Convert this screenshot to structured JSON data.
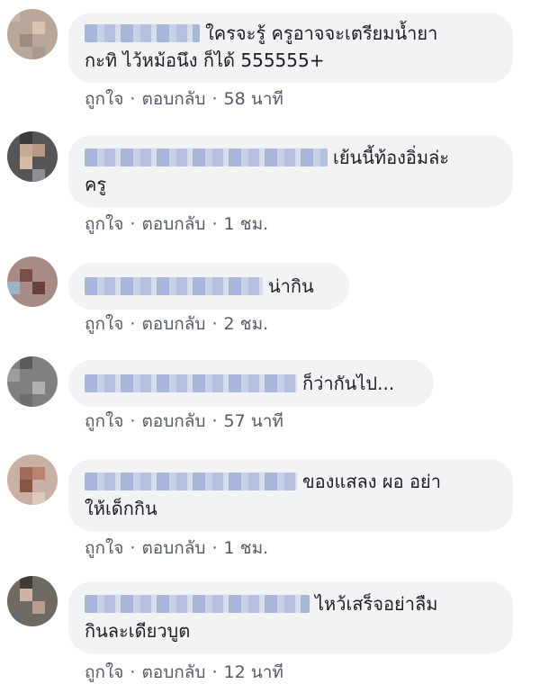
{
  "comments": [
    {
      "line1": "ใครจะรู้ ครูอาจจะเตรียมน้ำยา",
      "line2": "กะทิ ไว้หม้อนึง ก็ได้ 555555+",
      "time": "58 นาที"
    },
    {
      "line1": "เย้นนี้ท้องอิ่มล่ะ",
      "line2": "ครู",
      "time": "1 ชม."
    },
    {
      "line1": "น่ากิน",
      "line2": "",
      "time": "2 ชม."
    },
    {
      "line1": "ก็ว่ากันไป...",
      "line2": "",
      "time": "57 นาที"
    },
    {
      "line1": "ของแสลง ผอ อย่า",
      "line2": "ให้เด็กกิน",
      "time": "1 ชม."
    },
    {
      "line1": "ไหว้เสร็จอย่าลืม",
      "line2": "กินละเดียวบูต",
      "time": "12 นาที"
    }
  ],
  "actions": {
    "like": "ถูกใจ",
    "reply": "ตอบกลับ",
    "separator": "·"
  }
}
